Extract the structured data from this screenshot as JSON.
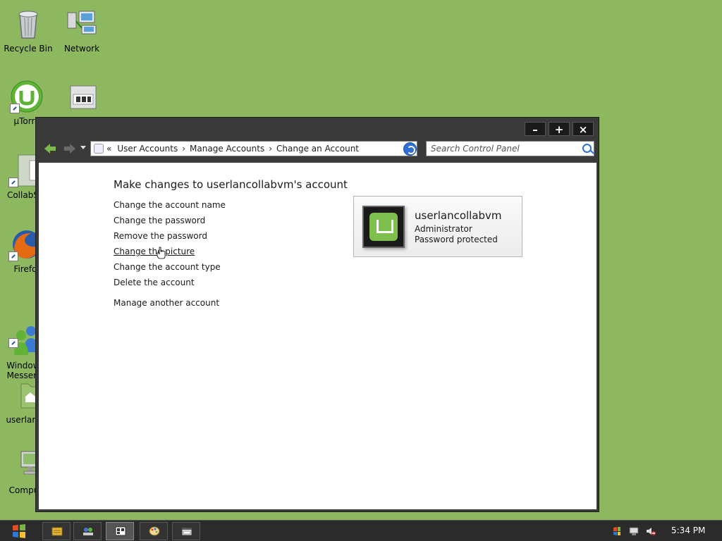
{
  "desktop": {
    "icons": [
      {
        "label": "Recycle Bin",
        "icon": "recycle-bin-icon"
      },
      {
        "label": "Network",
        "icon": "network-icon"
      },
      {
        "label": "µTorre",
        "icon": "utorrent-icon"
      },
      {
        "label": "",
        "icon": "drive-icon"
      },
      {
        "label": "CollabSy",
        "icon": "app-icon"
      },
      {
        "label": "Firefo",
        "icon": "firefox-icon"
      },
      {
        "label": "Windows\nMesseng",
        "icon": "messenger-icon"
      },
      {
        "label": "userlanc",
        "icon": "user-folder-icon"
      },
      {
        "label": "Compu",
        "icon": "computer-icon"
      }
    ]
  },
  "window": {
    "controls": {
      "minimize": "–",
      "maximize": "+",
      "close": "×"
    },
    "breadcrumb": {
      "prefix": "«",
      "items": [
        "User Accounts",
        "Manage Accounts",
        "Change an Account"
      ],
      "separator": "›"
    },
    "search": {
      "placeholder": "Search Control Panel"
    },
    "page_title": "Make changes to userlancollabvm's account",
    "tasks": [
      "Change the account name",
      "Change the password",
      "Remove the password",
      "Change the picture",
      "Change the account type",
      "Delete the account"
    ],
    "other_task": "Manage another account",
    "user_card": {
      "name": "userlancollabvm",
      "role": "Administrator",
      "status": "Password protected"
    }
  },
  "taskbar": {
    "clock": "5:34 PM"
  },
  "colors": {
    "desktop": "#8db85f",
    "window_frame": "#3a3a3a",
    "accent": "#2f6fd8"
  }
}
